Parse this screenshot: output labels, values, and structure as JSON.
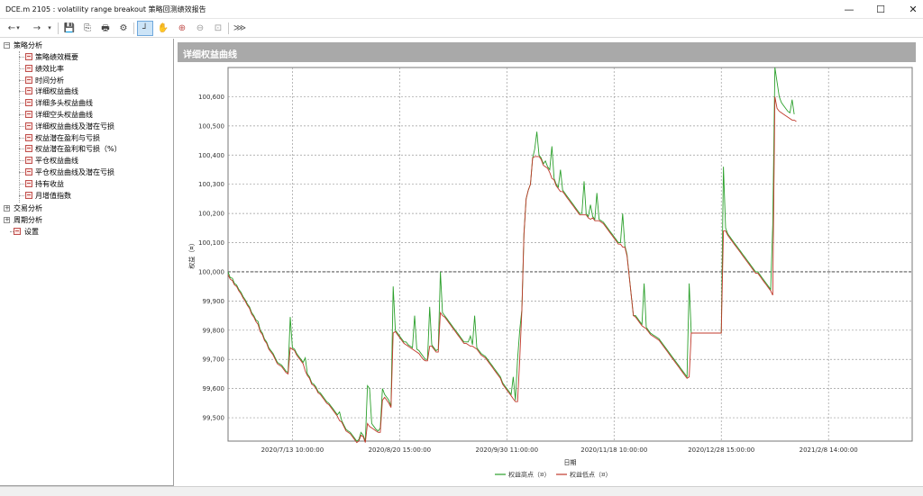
{
  "window": {
    "title": "DCE.m 2105 : volatility range breakout 策略回测绩效报告",
    "minimize": "—",
    "maximize": "☐",
    "close": "✕"
  },
  "toolbar": {
    "back": "←",
    "forward": "→",
    "dropdown": "▾",
    "save": "💾",
    "copy": "⎘",
    "print": "🖶",
    "settings": "⚙",
    "crosshair": "┘",
    "hand": "✋",
    "zoom_in": "⊕",
    "zoom_out": "⊖",
    "fit": "⊡",
    "export": "⋙"
  },
  "tree": {
    "root_strategy": "策略分析",
    "items": [
      "策略绩效概要",
      "绩效比率",
      "时间分析",
      "详细权益曲线",
      "详细多头权益曲线",
      "详细空头权益曲线",
      "详细权益曲线及潜在亏损",
      "权益潜在盈利与亏损",
      "权益潜在盈利和亏损（%）",
      "平仓权益曲线",
      "平仓权益曲线及潜在亏损",
      "持有收益",
      "月增值指数"
    ],
    "trade_analysis": "交易分析",
    "period_analysis": "周期分析",
    "settings": "设置"
  },
  "panel": {
    "title": "详细权益曲线"
  },
  "chart_data": {
    "type": "line",
    "ylabel": "权益（¤）",
    "xlabel": "日期",
    "ylim": [
      99420,
      100700
    ],
    "yticks": [
      "99,500",
      "99,600",
      "99,700",
      "99,800",
      "99,900",
      "100,000",
      "100,100",
      "100,200",
      "100,300",
      "100,400",
      "100,500",
      "100,600"
    ],
    "ytick_values": [
      99500,
      99600,
      99700,
      99800,
      99900,
      100000,
      100100,
      100200,
      100300,
      100400,
      100500,
      100600
    ],
    "xticks": [
      "2020/7/13 10:00:00",
      "2020/8/20 15:00:00",
      "2020/9/30 11:00:00",
      "2020/11/18 10:00:00",
      "2020/12/28 15:00:00",
      "2021/2/8 14:00:00"
    ],
    "xtick_index": [
      30,
      80,
      130,
      180,
      230,
      280
    ],
    "x_count": 320,
    "reference_line": 100000,
    "grid": true,
    "legend_position": "bottom",
    "colors": {
      "high": "#2ca02c",
      "low": "#c0392b"
    },
    "series": [
      {
        "name": "权益高点（¤）",
        "key": "high",
        "values": [
          100000,
          99980,
          99978,
          99960,
          99955,
          99940,
          99930,
          99915,
          99905,
          99890,
          99880,
          99860,
          99850,
          99835,
          99830,
          99800,
          99790,
          99770,
          99760,
          99740,
          99730,
          99720,
          99705,
          99690,
          99685,
          99680,
          99670,
          99660,
          99655,
          99845,
          99740,
          99735,
          99720,
          99710,
          99700,
          99690,
          99705,
          99650,
          99640,
          99620,
          99615,
          99605,
          99590,
          99585,
          99575,
          99565,
          99555,
          99550,
          99540,
          99530,
          99520,
          99510,
          99520,
          99490,
          99475,
          99460,
          99455,
          99450,
          99440,
          99430,
          99420,
          99425,
          99450,
          99440,
          99420,
          99610,
          99600,
          99480,
          99470,
          99460,
          99455,
          99465,
          99600,
          99580,
          99570,
          99560,
          99540,
          99950,
          99800,
          99790,
          99780,
          99770,
          99760,
          99760,
          99750,
          99745,
          99740,
          99850,
          99735,
          99730,
          99720,
          99710,
          99700,
          99700,
          99880,
          99750,
          99740,
          99730,
          99735,
          100000,
          99860,
          99850,
          99840,
          99830,
          99820,
          99810,
          99800,
          99790,
          99780,
          99770,
          99760,
          99760,
          99760,
          99780,
          99750,
          99850,
          99740,
          99730,
          99720,
          99715,
          99710,
          99700,
          99690,
          99680,
          99670,
          99660,
          99650,
          99640,
          99620,
          99610,
          99600,
          99590,
          99580,
          99640,
          99560,
          99700,
          99800,
          99870,
          100130,
          100250,
          100280,
          100300,
          100390,
          100420,
          100480,
          100400,
          100390,
          100370,
          100380,
          100360,
          100350,
          100430,
          100320,
          100300,
          100290,
          100350,
          100280,
          100270,
          100260,
          100250,
          100240,
          100230,
          100220,
          100210,
          100200,
          100200,
          100310,
          100200,
          100190,
          100230,
          100190,
          100180,
          100270,
          100180,
          100175,
          100170,
          100160,
          100150,
          100140,
          100130,
          100120,
          100110,
          100100,
          100100,
          100200,
          100090,
          100060,
          99990,
          99920,
          99850,
          99850,
          99840,
          99830,
          99820,
          99960,
          99810,
          99800,
          99790,
          99785,
          99780,
          99775,
          99770,
          99760,
          99750,
          99740,
          99730,
          99720,
          99710,
          99700,
          99690,
          99680,
          99670,
          99660,
          99650,
          99640,
          99960,
          99790,
          99790,
          99790,
          99790,
          99790,
          99790,
          99790,
          99790,
          99790,
          99790,
          99790,
          99790,
          99790,
          99790,
          99790,
          100360,
          100150,
          100130,
          100120,
          100110,
          100100,
          100090,
          100080,
          100070,
          100060,
          100050,
          100040,
          100030,
          100020,
          100010,
          100000,
          100000,
          99990,
          99980,
          99970,
          99960,
          99950,
          99940,
          100160,
          100700,
          100650,
          100600,
          100580,
          100570,
          100560,
          100550,
          100545,
          100590,
          100540
        ]
      },
      {
        "name": "权益低点（¤）",
        "key": "low",
        "values": [
          99990,
          99975,
          99970,
          99955,
          99950,
          99935,
          99925,
          99910,
          99900,
          99885,
          99875,
          99855,
          99845,
          99830,
          99820,
          99795,
          99785,
          99765,
          99755,
          99735,
          99725,
          99715,
          99700,
          99685,
          99680,
          99675,
          99665,
          99655,
          99650,
          99740,
          99735,
          99730,
          99715,
          99705,
          99695,
          99685,
          99660,
          99645,
          99635,
          99615,
          99610,
          99600,
          99585,
          99580,
          99570,
          99560,
          99550,
          99545,
          99535,
          99525,
          99515,
          99505,
          99490,
          99485,
          99470,
          99455,
          99450,
          99445,
          99435,
          99425,
          99415,
          99420,
          99440,
          99435,
          99415,
          99480,
          99470,
          99465,
          99460,
          99455,
          99450,
          99450,
          99560,
          99570,
          99560,
          99550,
          99535,
          99790,
          99795,
          99785,
          99775,
          99765,
          99755,
          99750,
          99745,
          99740,
          99735,
          99730,
          99725,
          99720,
          99710,
          99700,
          99695,
          99695,
          99745,
          99745,
          99735,
          99725,
          99725,
          99860,
          99850,
          99845,
          99835,
          99825,
          99815,
          99805,
          99795,
          99785,
          99775,
          99765,
          99755,
          99755,
          99750,
          99745,
          99745,
          99740,
          99735,
          99725,
          99715,
          99710,
          99705,
          99695,
          99685,
          99675,
          99665,
          99655,
          99645,
          99635,
          99615,
          99605,
          99595,
          99585,
          99575,
          99565,
          99555,
          99555,
          99700,
          99870,
          100130,
          100250,
          100280,
          100300,
          100390,
          100395,
          100395,
          100395,
          100385,
          100365,
          100360,
          100355,
          100340,
          100320,
          100315,
          100295,
          100285,
          100275,
          100275,
          100265,
          100255,
          100245,
          100235,
          100225,
          100215,
          100205,
          100195,
          100195,
          100195,
          100195,
          100185,
          100180,
          100185,
          100175,
          100175,
          100175,
          100170,
          100165,
          100155,
          100145,
          100135,
          100125,
          100115,
          100105,
          100095,
          100095,
          100085,
          100085,
          100055,
          99990,
          99920,
          99850,
          99845,
          99835,
          99825,
          99815,
          99810,
          99805,
          99795,
          99785,
          99780,
          99775,
          99770,
          99765,
          99755,
          99745,
          99735,
          99725,
          99715,
          99705,
          99695,
          99685,
          99675,
          99665,
          99655,
          99645,
          99635,
          99640,
          99790,
          99790,
          99790,
          99790,
          99790,
          99790,
          99790,
          99790,
          99790,
          99790,
          99790,
          99790,
          99790,
          99790,
          99790,
          100140,
          100140,
          100125,
          100115,
          100105,
          100095,
          100085,
          100075,
          100065,
          100055,
          100045,
          100035,
          100025,
          100015,
          100005,
          99995,
          99995,
          99985,
          99975,
          99965,
          99955,
          99945,
          99935,
          99920,
          100600,
          100560,
          100550,
          100545,
          100540,
          100535,
          100530,
          100525,
          100520,
          100520,
          100515
        ]
      }
    ]
  },
  "legend": {
    "high": "权益高点（¤）",
    "low": "权益低点（¤）"
  }
}
